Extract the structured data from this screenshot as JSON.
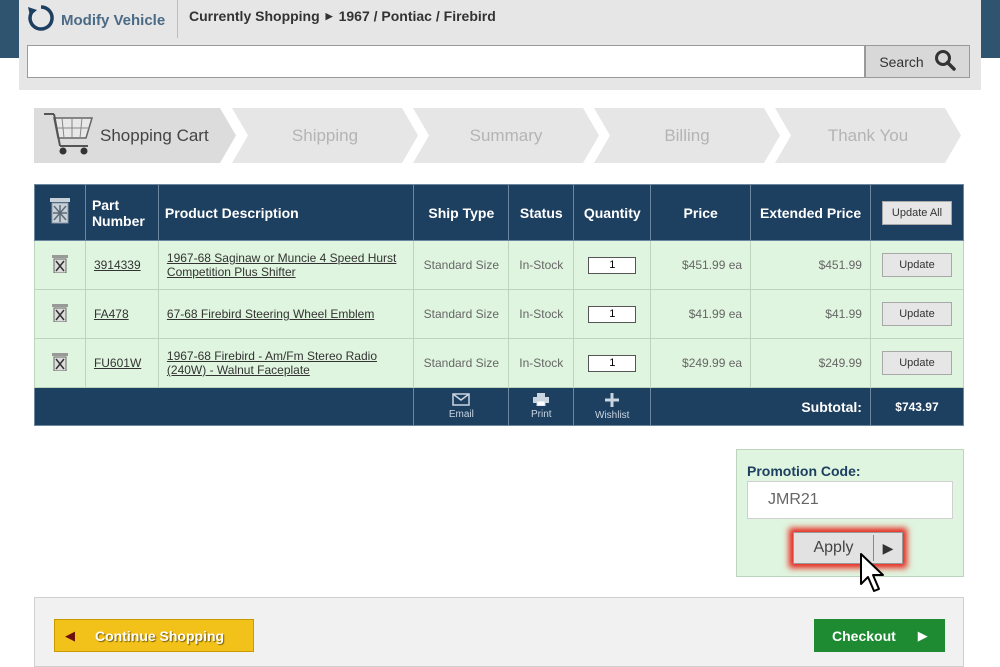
{
  "header": {
    "modify_label": "Modify Vehicle",
    "currently_label": "Currently Shopping",
    "vehicle": "1967 / Pontiac / Firebird",
    "search_placeholder": "",
    "search_label": "Search"
  },
  "steps": [
    "Shopping Cart",
    "Shipping",
    "Summary",
    "Billing",
    "Thank You"
  ],
  "table": {
    "headers": {
      "part_number": "Part Number",
      "description": "Product Description",
      "ship_type": "Ship Type",
      "status": "Status",
      "quantity": "Quantity",
      "price": "Price",
      "extended_price": "Extended Price",
      "update_all": "Update All"
    },
    "rows": [
      {
        "part": "3914339",
        "description": "1967-68 Saginaw or Muncie 4 Speed Hurst Competition Plus Shifter",
        "ship_type": "Standard Size",
        "status": "In-Stock",
        "qty": "1",
        "price": "$451.99",
        "unit": "ea",
        "extended": "$451.99",
        "update": "Update"
      },
      {
        "part": "FA478",
        "description": "67-68 Firebird Steering Wheel Emblem",
        "ship_type": "Standard Size",
        "status": "In-Stock",
        "qty": "1",
        "price": "$41.99",
        "unit": "ea",
        "extended": "$41.99",
        "update": "Update"
      },
      {
        "part": "FU601W",
        "description": "1967-68 Firebird - Am/Fm Stereo Radio (240W) - Walnut Faceplate",
        "ship_type": "Standard Size",
        "status": "In-Stock",
        "qty": "1",
        "price": "$249.99",
        "unit": "ea",
        "extended": "$249.99",
        "update": "Update"
      }
    ],
    "footer": {
      "email": "Email",
      "print": "Print",
      "wishlist": "Wishlist",
      "subtotal_label": "Subtotal:",
      "subtotal_value": "$743.97"
    }
  },
  "promo": {
    "label": "Promotion Code:",
    "value": "JMR21",
    "apply_label": "Apply"
  },
  "actions": {
    "continue_label": "Continue Shopping",
    "checkout_label": "Checkout"
  },
  "colors": {
    "header_blue": "#1d3f60",
    "row_green": "#dff5df",
    "continue_yellow": "#f2c21a",
    "checkout_green": "#1e8a32",
    "highlight_red": "#e8231a"
  }
}
